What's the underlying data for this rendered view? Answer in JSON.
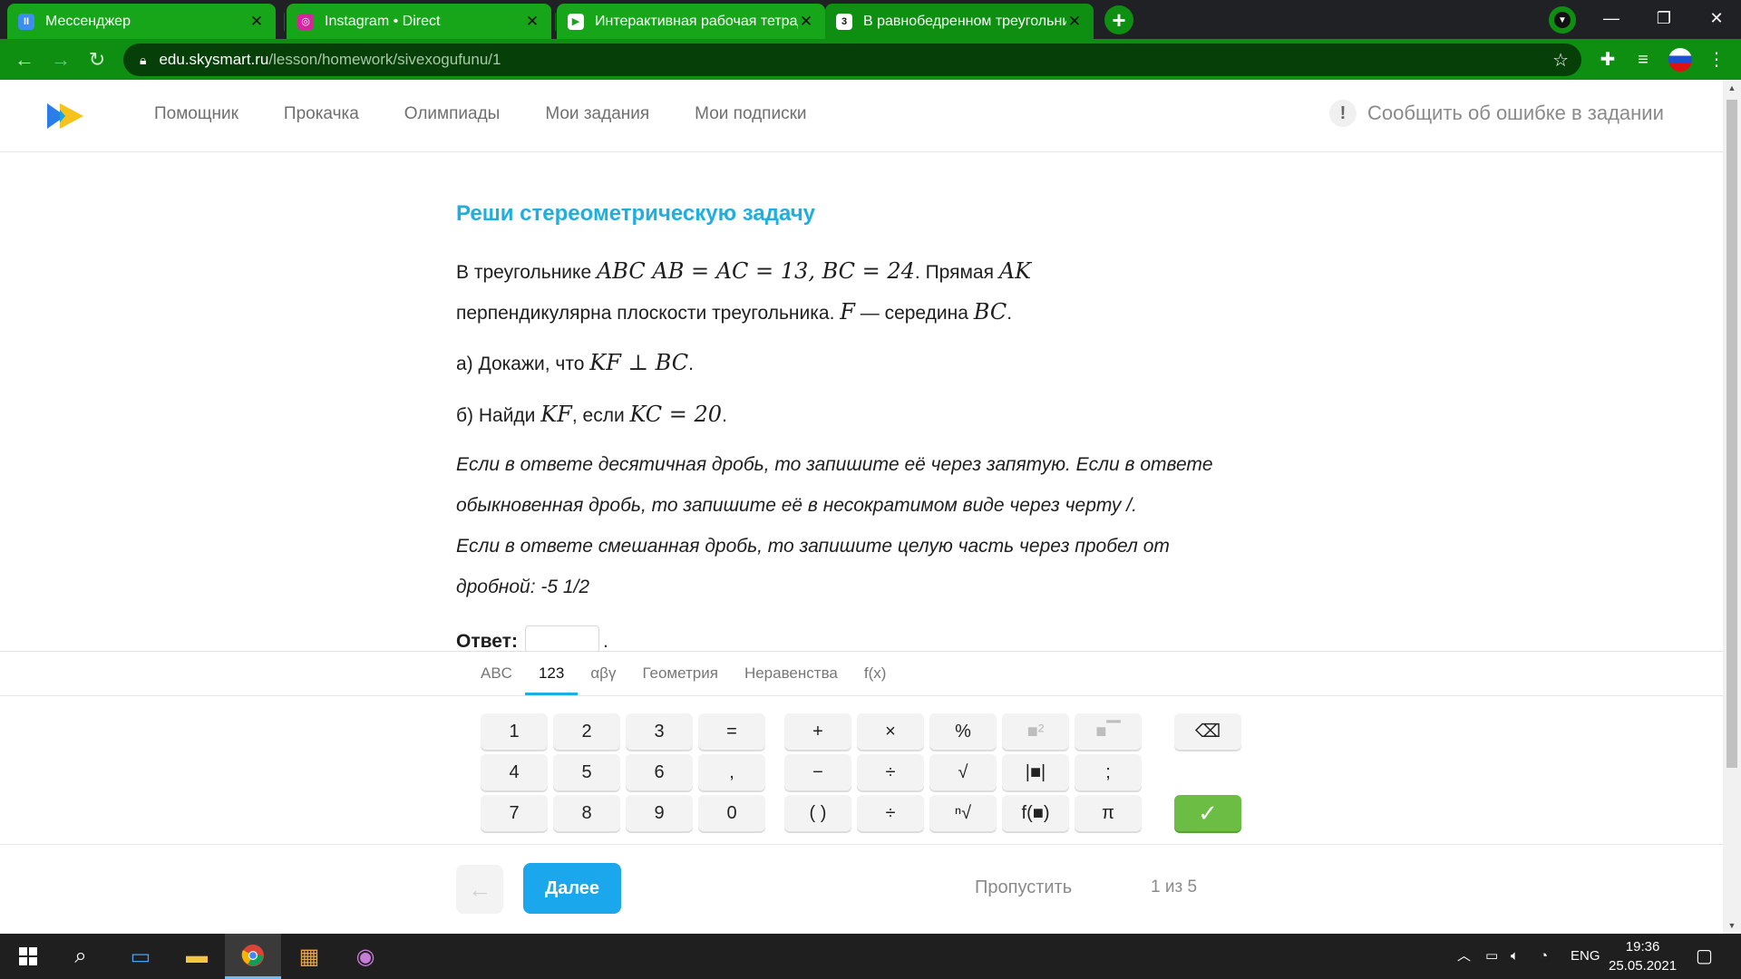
{
  "browser": {
    "tabs": [
      {
        "title": "Мессенджер",
        "favicon": "II",
        "favicon_color": "#3b8ef0"
      },
      {
        "title": "Instagram • Direct",
        "favicon": "◎",
        "favicon_color": "#d6249f"
      },
      {
        "title": "Интерактивная рабочая тетрадь",
        "favicon": "▶",
        "favicon_color": "#ffffff"
      },
      {
        "title": "В равнобедренном треугольнике",
        "favicon": "3",
        "favicon_color": "#111111"
      }
    ],
    "active_tab_index": 3,
    "new_tab": "+",
    "url_host": "edu.skysmart.ru",
    "url_path": "/lesson/homework/sivexogufunu/1"
  },
  "site": {
    "nav": [
      "Помощник",
      "Прокачка",
      "Олимпиады",
      "Мои задания",
      "Мои подписки"
    ],
    "report": "Сообщить об ошибке в задании",
    "report_icon": "!"
  },
  "task": {
    "title": "Реши стереометрическую задачу",
    "line1_text_a": "В треугольнике ",
    "line1_math": "ABC AB = AC = 13, BC = 24",
    "line1_text_b": ". Прямая ",
    "line1_math_b": "AK",
    "line2_text_a": "перпендикулярна плоскости треугольника. ",
    "line2_math_a": "F",
    "line2_text_b": " — середина ",
    "line2_math_b": "BC",
    "line2_text_c": ".",
    "part_a_text": "а) Докажи, что ",
    "part_a_math": "KF ⊥ BC",
    "part_a_end": ".",
    "part_b_text": "б) Найди ",
    "part_b_math": "KF",
    "part_b_mid": ", если ",
    "part_b_math2": "KC = 20",
    "part_b_end": ".",
    "hint_lines": [
      "Если в ответе десятичная дробь, то запишите её через запятую. Если в ответе",
      "обыкновенная дробь, то запишите её в несократимом виде через черту /.",
      "Если в ответе смешанная дробь, то запишите целую часть через пробел от",
      "дробной: -5 1/2"
    ],
    "answer_label": "Ответ:",
    "answer_value": "",
    "answer_tail": "."
  },
  "keyboard": {
    "tabs": [
      "ABC",
      "123",
      "αβγ",
      "Геометрия",
      "Неравенства",
      "f(x)"
    ],
    "active_tab": "123",
    "digits_row1": [
      "1",
      "2",
      "3",
      "="
    ],
    "digits_row2": [
      "4",
      "5",
      "6",
      ","
    ],
    "digits_row3": [
      "7",
      "8",
      "9",
      "0"
    ],
    "ops_row1": [
      "+",
      "×",
      "%",
      "■²",
      "■▔"
    ],
    "ops_row2": [
      "−",
      "÷",
      "√",
      "|■|",
      ";"
    ],
    "ops_row3": [
      "( )",
      "÷",
      "ⁿ√",
      "f(■)",
      "π"
    ],
    "backspace": "⌫",
    "submit": "✓"
  },
  "footer": {
    "back": "←",
    "next": "Далее",
    "skip": "Пропустить",
    "progress": "1 из 5"
  },
  "taskbar": {
    "lang": "ENG",
    "time": "19:36",
    "date": "25.05.2021"
  },
  "colors": {
    "accent": "#1faee0",
    "chrome_green": "#0e8f12",
    "next_button": "#1aa7ec",
    "submit_green": "#6cbd44"
  }
}
